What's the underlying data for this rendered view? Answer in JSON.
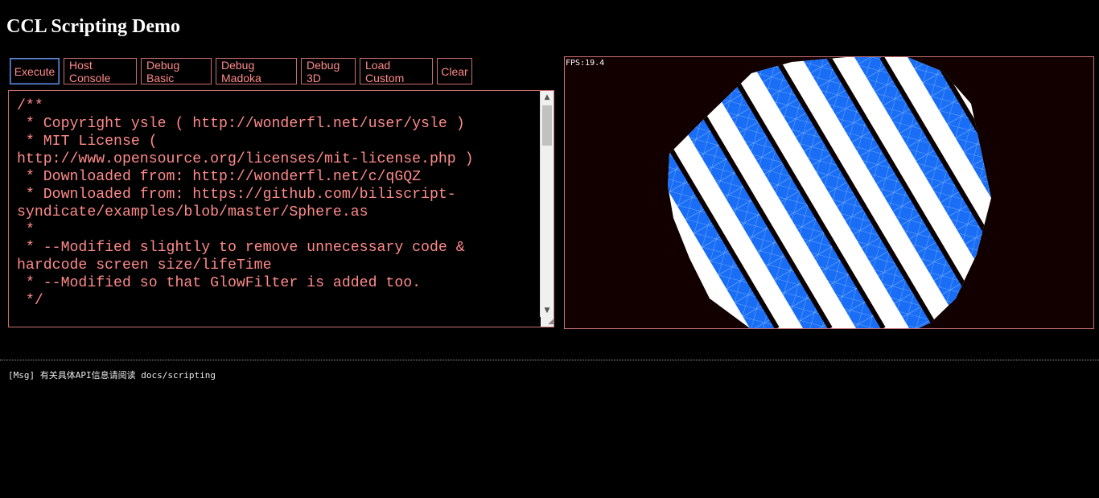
{
  "page": {
    "title": "CCL Scripting Demo"
  },
  "toolbar": {
    "buttons": [
      {
        "label": "Execute"
      },
      {
        "label": "Host Console"
      },
      {
        "label": "Debug Basic"
      },
      {
        "label": "Debug Madoka"
      },
      {
        "label": "Debug 3D"
      },
      {
        "label": "Load Custom"
      },
      {
        "label": "Clear"
      }
    ]
  },
  "editor": {
    "code": "/**\n * Copyright ysle ( http://wonderfl.net/user/ysle )\n * MIT License (\nhttp://www.opensource.org/licenses/mit-license.php )\n * Downloaded from: http://wonderfl.net/c/qGQZ\n * Downloaded from: https://github.com/biliscript-\nsyndicate/examples/blob/master/Sphere.as\n *\n * --Modified slightly to remove unnecessary code &\nhardcode screen size/lifeTime\n * --Modified so that GlowFilter is added too.\n */"
  },
  "stage": {
    "fps_text": "FPS:19.4",
    "stripe_color": "#1a6ef5",
    "gap_color": "#ffffff",
    "background_color": "#120000"
  },
  "console": {
    "message": "[Msg] 有关具体API信息请阅读 docs/scripting"
  },
  "colors": {
    "accent": "#ff8a8a",
    "border": "#c96f6f",
    "background": "#000000"
  }
}
